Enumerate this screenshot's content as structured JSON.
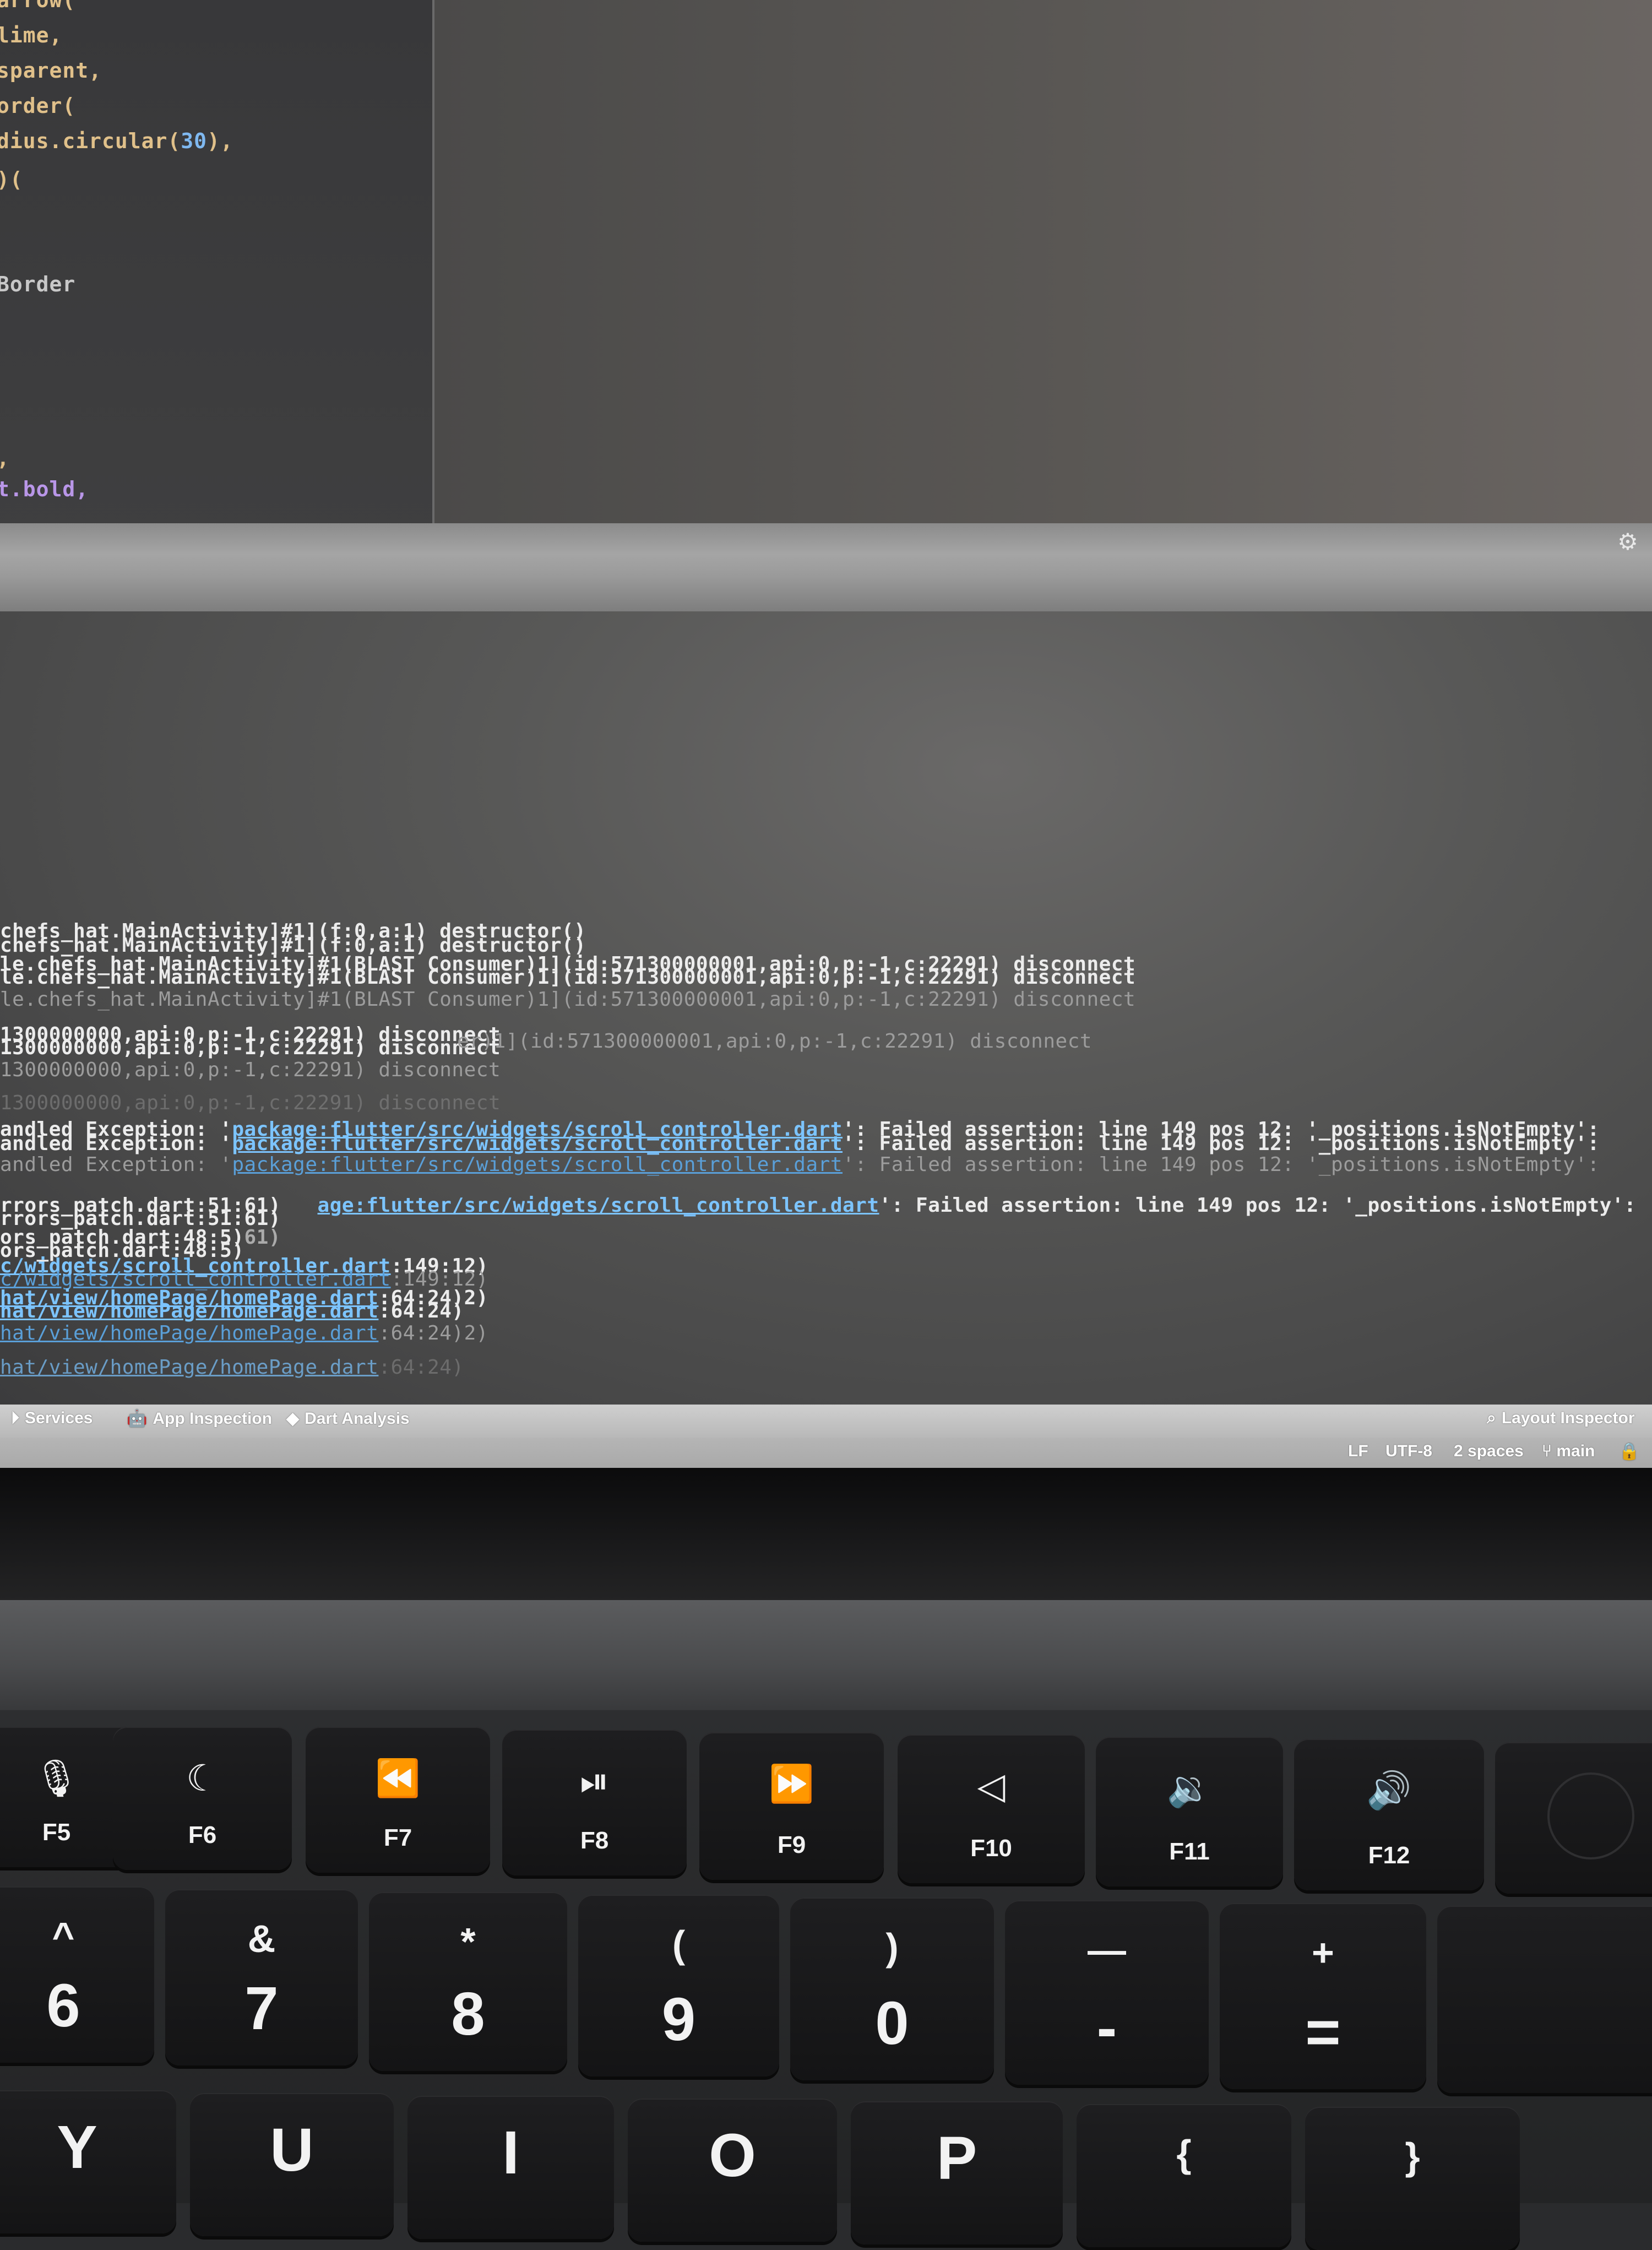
{
  "editor": {
    "code_lines": [
      {
        "text": "arrow(",
        "kind": "code"
      },
      {
        "text": "lime,",
        "kind": "code"
      },
      {
        "text": "sparent,",
        "kind": "code"
      },
      {
        "text": "order(",
        "kind": "code"
      },
      {
        "text_a": "dius.circular(",
        "num": "30",
        "text_b": "),",
        "kind": "num"
      },
      {
        "text": ")(",
        "kind": "code"
      },
      {
        "text": "Border",
        "kind": "plain"
      },
      {
        "text": ",",
        "kind": "code"
      },
      {
        "text": "t.bold,",
        "kind": "field"
      }
    ]
  },
  "console": {
    "lines": [
      {
        "text": "chefs_hat.MainActivity]#1](f:0,a:1) destructor()",
        "style": "bright"
      },
      {
        "text": "chefs_hat.MainActivity]#1](f:0,a:1) destructor()",
        "style": "bright"
      },
      {
        "text": "le.chefs_hat.MainActivity]#1(BLAST Consumer)1](id:571300000001,api:0,p:-1,c:22291) disconnect",
        "style": "bright"
      },
      {
        "text": "le.chefs_hat.MainActivity]#1(BLAST Consumer)1](id:571300000001,api:0,p:-1,c:22291) disconnect",
        "style": "bright"
      },
      {
        "text": "le.chefs_hat.MainActivity]#1(BLAST Consumer)1](id:571300000001,api:0,p:-1,c:22291) disconnect",
        "style": "dim"
      },
      {
        "text": "1300000000,api:0,p:-1,c:22291) disconnect",
        "style": "bright"
      },
      {
        "text": "1300000000,api:0,p:-1,c:22291) disconnect",
        "style": "bright"
      },
      {
        "text": "er)1](id:571300000001,api:0,p:-1,c:22291) disconnect",
        "style": "dim"
      },
      {
        "text": "1300000000,api:0,p:-1,c:22291) disconnect",
        "style": "dim"
      },
      {
        "text": "1300000000,api:0,p:-1,c:22291) disconnect",
        "style": "dim"
      }
    ],
    "exceptions": [
      {
        "prefix": "andled Exception: '",
        "link": "package:flutter/src/widgets/scroll_controller.dart",
        "suffix": "': Failed assertion: line 149 pos 12: '_positions.isNotEmpty':",
        "style": "bright"
      },
      {
        "prefix": "andled Exception: '",
        "link": "package:flutter/src/widgets/scroll_controller.dart",
        "suffix": "': Failed assertion: line 149 pos 12: '_positions.isNotEmpty':",
        "style": "bright"
      },
      {
        "prefix": "andled Exception: '",
        "link": "package:flutter/src/widgets/scroll_controller.dart",
        "suffix": "': Failed assertion: line 149 pos 12: '_positions.isNotEmpty':",
        "style": "dim"
      },
      {
        "prefix": "rrors_patch.dart:51:61)   ",
        "link": "age:flutter/src/widgets/scroll_controller.dart",
        "suffix": "': Failed assertion: line 149 pos 12: '_positions.isNotEmpty':",
        "style": "bright"
      },
      {
        "prefix": "rrors_patch.dart:51:61)",
        "link": "",
        "suffix": "",
        "style": "bright"
      },
      {
        "prefix": "ors_patch.dart:48:5)",
        "link": "",
        "suffix": "61)",
        "style": "bright"
      },
      {
        "prefix": "ors_patch.dart:48:5)",
        "link": "",
        "suffix": "",
        "style": "bright"
      },
      {
        "prefix": "",
        "link": "c/widgets/scroll_controller.dart",
        "suffix": ":149:12)",
        "style": "bright"
      },
      {
        "prefix": "",
        "link": "c/widgets/scroll_controller.dart",
        "suffix": ":149:12)",
        "style": "dim"
      },
      {
        "prefix": "",
        "link": "hat/view/homePage/homePage.dart",
        "suffix": ":64:24)2)",
        "style": "bright"
      },
      {
        "prefix": "",
        "link": "hat/view/homePage/homePage.dart",
        "suffix": ":64:24)",
        "style": "bright"
      },
      {
        "prefix": "",
        "link": "hat/view/homePage/homePage.dart",
        "suffix": ":64:24)2)",
        "style": "dim"
      },
      {
        "prefix": "",
        "link": "hat/view/homePage/homePage.dart",
        "suffix": ":64:24)",
        "style": "faint"
      }
    ]
  },
  "status_tabs": {
    "services": "Services",
    "app_inspection": "App Inspection",
    "dart_analysis": "Dart Analysis",
    "layout_inspector": "Layout Inspector"
  },
  "status_bar": {
    "line_sep": "LF",
    "encoding": "UTF-8",
    "indent": "2 spaces",
    "branch": "main"
  },
  "keyboard": {
    "fkeys": [
      {
        "label": "F5",
        "glyph": "🎙"
      },
      {
        "label": "F6",
        "glyph": "☾"
      },
      {
        "label": "F7",
        "glyph": "⏪"
      },
      {
        "label": "F8",
        "glyph": "⏯"
      },
      {
        "label": "F9",
        "glyph": "⏩"
      },
      {
        "label": "F10",
        "glyph": "◁"
      },
      {
        "label": "F11",
        "glyph": "🔉"
      },
      {
        "label": "F12",
        "glyph": "🔊"
      }
    ],
    "number_keys": [
      {
        "top": "^",
        "bottom": "6"
      },
      {
        "top": "&",
        "bottom": "7"
      },
      {
        "top": "*",
        "bottom": "8"
      },
      {
        "top": "(",
        "bottom": "9"
      },
      {
        "top": ")",
        "bottom": "0"
      },
      {
        "top": "—",
        "bottom": "-"
      },
      {
        "top": "+",
        "bottom": "="
      }
    ],
    "bottom_row": [
      {
        "glyph": "Y"
      },
      {
        "glyph": "U"
      },
      {
        "glyph": "I"
      },
      {
        "glyph": "O"
      },
      {
        "glyph": "P"
      },
      {
        "glyph": "{"
      },
      {
        "glyph": "}"
      }
    ]
  }
}
